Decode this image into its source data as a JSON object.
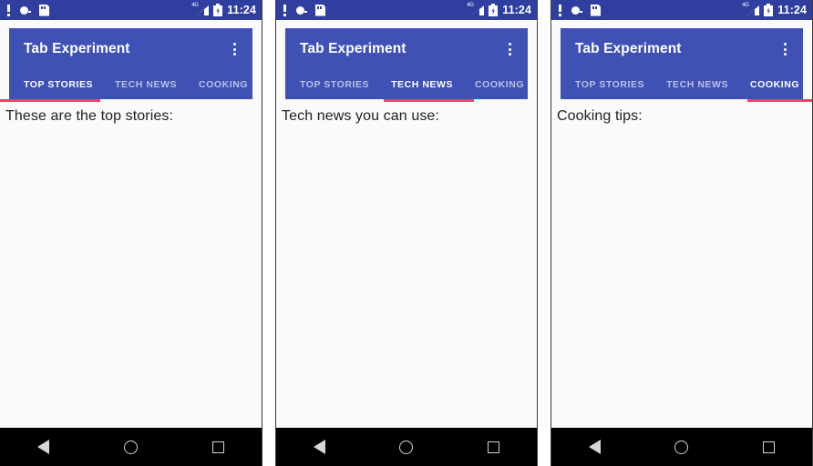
{
  "statusbar": {
    "icons_left": [
      "alert-icon",
      "bug-report-icon",
      "sd-card-icon"
    ],
    "network_label": "4G",
    "icons_right": [
      "signal-icon",
      "battery-charging-icon"
    ],
    "time": "11:24",
    "background": "#303F9F"
  },
  "appbar": {
    "title": "Tab Experiment",
    "overflow_label": "More options",
    "background": "#3F51B5",
    "indicator_color": "#FF3B6B"
  },
  "tabs": [
    {
      "label": "TOP STORIES"
    },
    {
      "label": "TECH NEWS"
    },
    {
      "label": "COOKING"
    }
  ],
  "navbar": {
    "back_label": "Back",
    "home_label": "Home",
    "recents_label": "Recents"
  },
  "screens": [
    {
      "active_tab_index": 0,
      "content_text": "These are the top stories:"
    },
    {
      "active_tab_index": 1,
      "content_text": "Tech news you can use:"
    },
    {
      "active_tab_index": 2,
      "content_text": "Cooking tips:"
    }
  ]
}
